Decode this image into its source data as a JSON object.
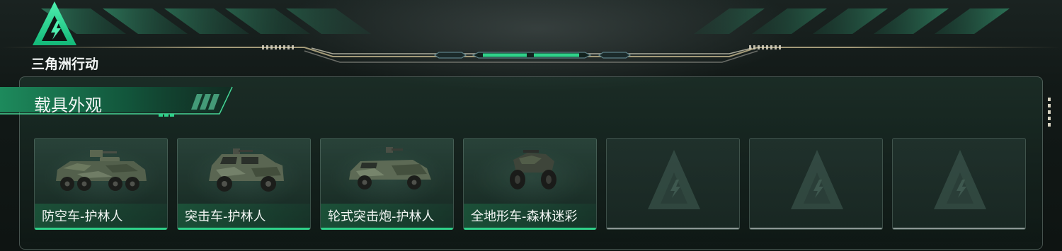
{
  "brand": {
    "name": "三角洲行动",
    "logo_icon": "delta-triangle-logo-icon",
    "accent": "#2fd18a"
  },
  "section": {
    "title": "载具外观"
  },
  "cards": [
    {
      "name": "防空车-护林人",
      "icon": "anti-air-apc-icon",
      "state": "owned"
    },
    {
      "name": "突击车-护林人",
      "icon": "assault-vehicle-icon",
      "state": "owned"
    },
    {
      "name": "轮式突击炮-护林人",
      "icon": "wheeled-assault-gun-icon",
      "state": "owned"
    },
    {
      "name": "全地形车-森林迷彩",
      "icon": "atv-icon",
      "state": "owned"
    },
    {
      "name": "",
      "icon": "delta-placeholder-icon",
      "state": "empty"
    },
    {
      "name": "",
      "icon": "delta-placeholder-icon",
      "state": "empty"
    },
    {
      "name": "",
      "icon": "delta-placeholder-icon",
      "state": "empty"
    }
  ]
}
